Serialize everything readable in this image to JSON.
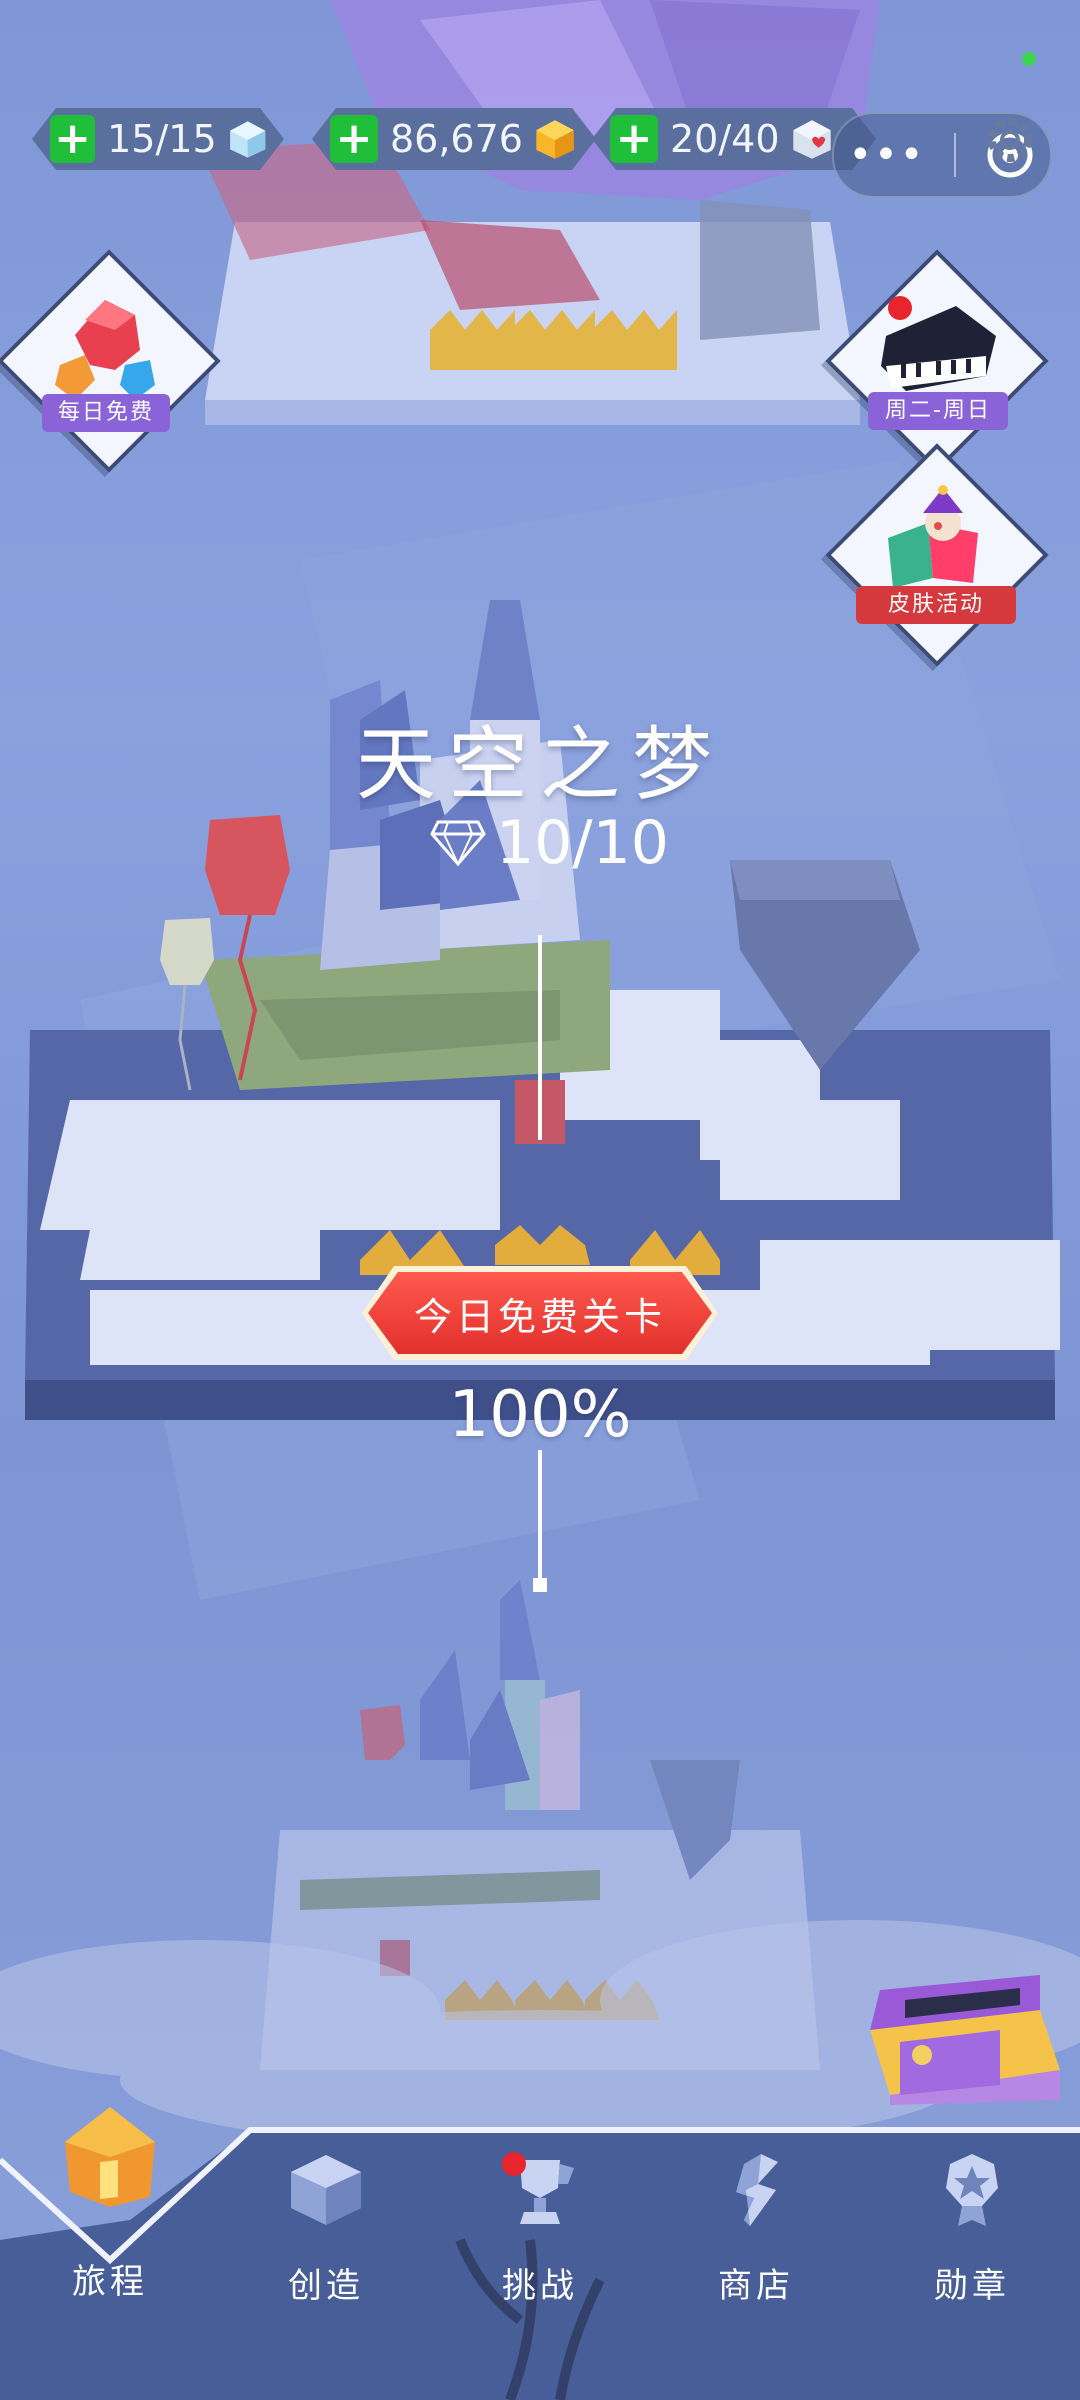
{
  "resources": [
    {
      "value": "15/15",
      "icon": "blue-cube-icon"
    },
    {
      "value": "86,676",
      "icon": "gold-gem-icon"
    },
    {
      "value": "20/40",
      "icon": "heart-box-icon"
    }
  ],
  "events": {
    "daily_free": "每日免费",
    "weekday": "周二-周日",
    "skin": "皮肤活动"
  },
  "level": {
    "title": "天空之梦",
    "gems": "10/10",
    "progress": "100%",
    "free_banner": "今日免费关卡"
  },
  "nav": [
    {
      "label": "旅程",
      "icon": "house-icon"
    },
    {
      "label": "创造",
      "icon": "cube-icon"
    },
    {
      "label": "挑战",
      "icon": "trophy-icon"
    },
    {
      "label": "商店",
      "icon": "shop-icon"
    },
    {
      "label": "勋章",
      "icon": "medal-icon"
    }
  ],
  "colors": {
    "accent_green": "#1fbf3a",
    "banner_red": "#e2302c",
    "background": "#8aa1de"
  }
}
